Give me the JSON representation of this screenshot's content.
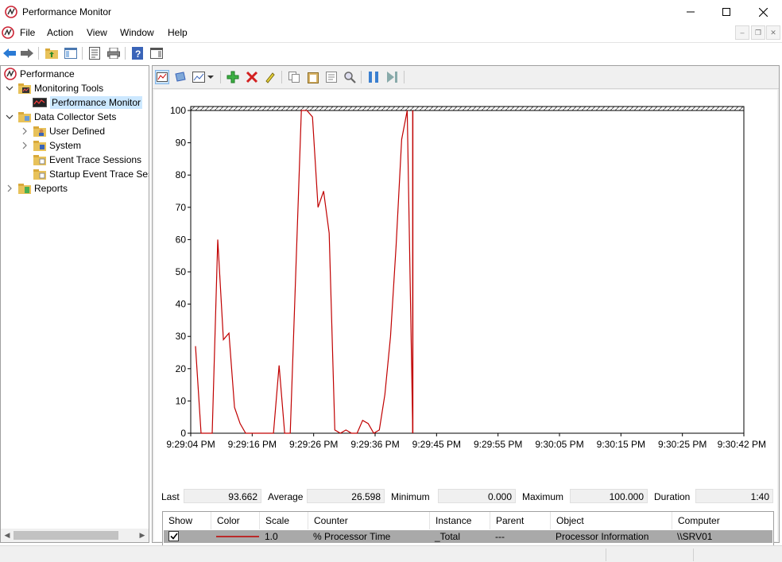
{
  "window": {
    "title": "Performance Monitor"
  },
  "menu": [
    "File",
    "Action",
    "View",
    "Window",
    "Help"
  ],
  "tree": {
    "root": "Performance",
    "monitoring_tools": "Monitoring Tools",
    "performance_monitor": "Performance Monitor",
    "data_collector_sets": "Data Collector Sets",
    "user_defined": "User Defined",
    "system": "System",
    "event_trace_sessions": "Event Trace Sessions",
    "startup_event_trace": "Startup Event Trace Ses",
    "reports": "Reports"
  },
  "stats": {
    "last_label": "Last",
    "last": "93.662",
    "average_label": "Average",
    "average": "26.598",
    "minimum_label": "Minimum",
    "minimum": "0.000",
    "maximum_label": "Maximum",
    "maximum": "100.000",
    "duration_label": "Duration",
    "duration": "1:40"
  },
  "legend": {
    "headers": {
      "show": "Show",
      "color": "Color",
      "scale": "Scale",
      "counter": "Counter",
      "instance": "Instance",
      "parent": "Parent",
      "object": "Object",
      "computer": "Computer"
    },
    "row": {
      "scale": "1.0",
      "counter": "% Processor Time",
      "instance": "_Total",
      "parent": "---",
      "object": "Processor Information",
      "computer": "\\\\SRV01",
      "color": "#c00000"
    }
  },
  "chart_data": {
    "type": "line",
    "ylim": [
      0,
      100
    ],
    "y_ticks": [
      "0",
      "10",
      "20",
      "30",
      "40",
      "50",
      "60",
      "70",
      "80",
      "90",
      "100"
    ],
    "x_ticks": [
      "9:29:04 PM",
      "9:29:16 PM",
      "9:29:26 PM",
      "9:29:36 PM",
      "9:29:45 PM",
      "9:29:55 PM",
      "9:30:05 PM",
      "9:30:15 PM",
      "9:30:25 PM",
      "9:30:42 PM"
    ],
    "series": [
      {
        "color": "#c00000",
        "values": [
          27,
          0,
          0,
          0,
          60,
          29,
          31,
          8,
          3,
          0,
          0,
          0,
          0,
          0,
          0,
          21,
          0,
          0,
          50,
          100,
          100,
          98,
          70,
          75,
          62,
          1,
          0,
          1,
          0,
          0,
          4,
          3,
          0,
          1,
          12,
          30,
          58,
          91,
          100,
          0
        ]
      }
    ]
  }
}
